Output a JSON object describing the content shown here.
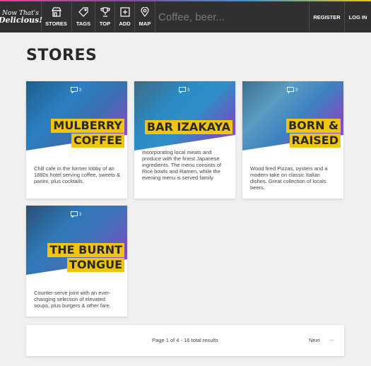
{
  "header": {
    "logo_line1": "Now That's",
    "logo_line2": "Delicious!",
    "nav": [
      {
        "label": "STORES",
        "icon": "store-icon"
      },
      {
        "label": "TAGS",
        "icon": "tag-icon"
      },
      {
        "label": "TOP",
        "icon": "trophy-icon"
      },
      {
        "label": "ADD",
        "icon": "add-icon"
      },
      {
        "label": "MAP",
        "icon": "map-pin-icon"
      }
    ],
    "search_placeholder": "Coffee, beer...",
    "register_label": "REGISTER",
    "login_label": "LOG IN"
  },
  "page": {
    "title": "STORES"
  },
  "stores": [
    {
      "name_lines": [
        "MULBERRY",
        "COFFEE"
      ],
      "review_count": "3",
      "description": "Chill cafe in the former lobby of an 1880s hotel serving coffee, sweets & panini, plus cocktails."
    },
    {
      "name_lines": [
        "BAR IZAKAYA"
      ],
      "review_count": "3",
      "description": "Incorporating local meats and produce with the finest Japanese ingredients. The menu consists of Rice bowls and Ramen, while the evening menu is served family"
    },
    {
      "name_lines": [
        "BORN &",
        "RAISED"
      ],
      "review_count": "3",
      "description": "Wood fired Pizzas, oysters and a modern take on classic Italian dishes. Great collection of locals beers."
    },
    {
      "name_lines": [
        "THE BURNT",
        "TONGUE"
      ],
      "review_count": "3",
      "description": "Counter-serve joint with an ever-changing selection of elevated soups, plus burgers & other fare."
    }
  ],
  "pagination": {
    "info": "Page 1 of 4 - 16 total results",
    "next_label": "Next",
    "next_arrow": "→"
  },
  "colors": {
    "header_bg": "#303030",
    "page_bg": "#f0f0f0",
    "highlight_yellow": "#f1c40f",
    "hero_blue": "#2a7fc1",
    "hero_purple": "#8e3fbf"
  }
}
